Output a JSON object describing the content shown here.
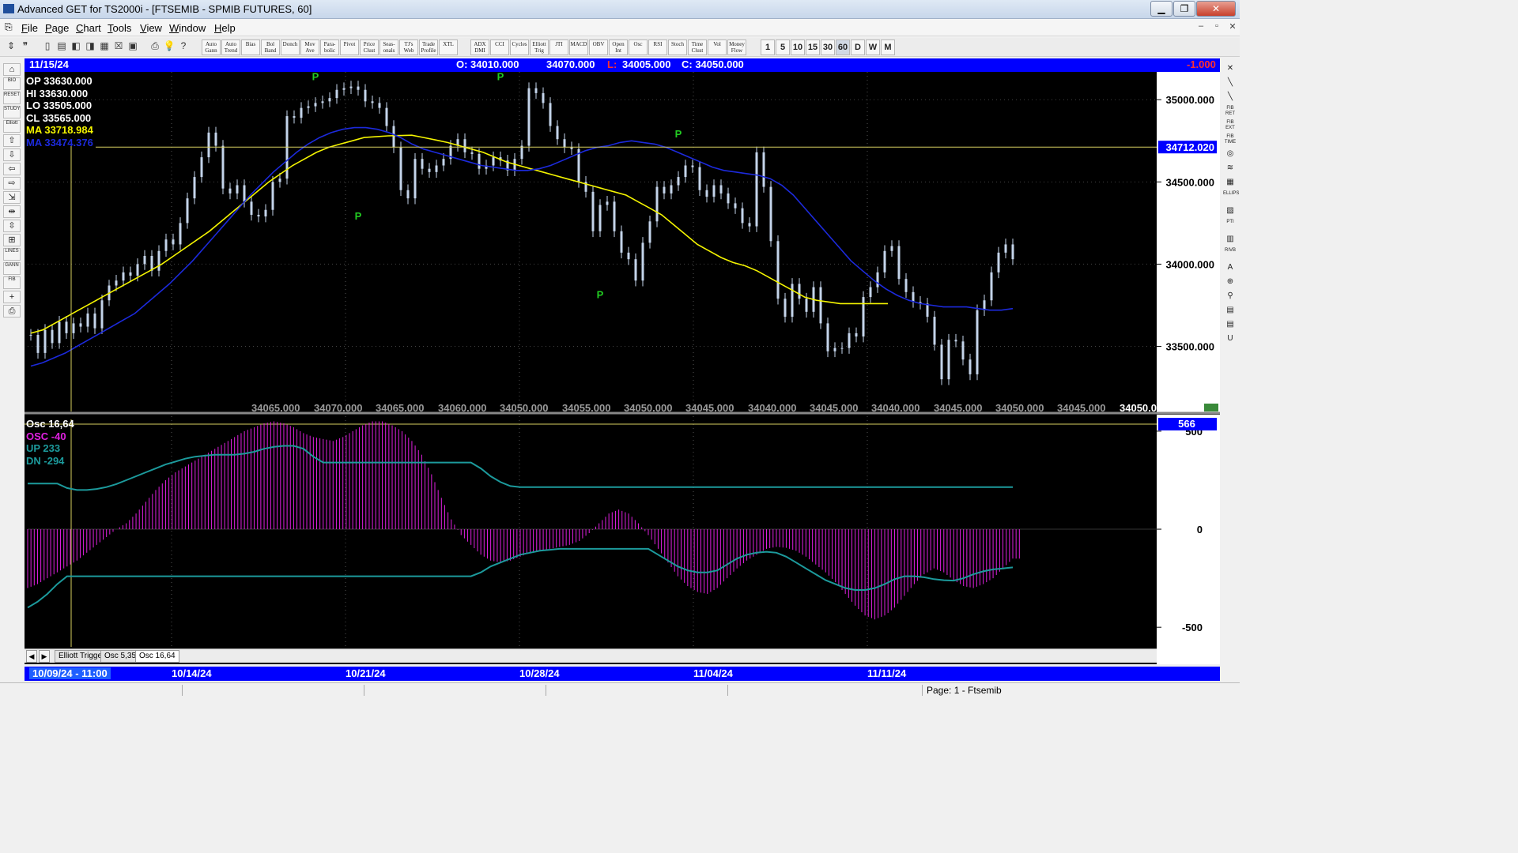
{
  "window": {
    "title": "Advanced GET for TS2000i - [FTSEMIB - SPMIB FUTURES, 60]",
    "minimize": "▁",
    "restore": "❐",
    "close": "✕"
  },
  "menu": {
    "items": [
      "File",
      "Page",
      "Chart",
      "Tools",
      "View",
      "Window",
      "Help"
    ],
    "mdi_min": "–",
    "mdi_restore": "▫",
    "mdi_close": "✕"
  },
  "toolbar": {
    "study_buttons": [
      "Auto\nGann",
      "Auto\nTrend",
      "Bias",
      "Bol\nBand",
      "Donch",
      "Mov\nAve",
      "Para-\nbolic",
      "Pivot",
      "Price\nClust",
      "Seas-\nonals",
      "TJ's\nWeb",
      "Trade\nProfile",
      "XTL"
    ],
    "indicator_buttons": [
      "ADX\nDMI",
      "CCI",
      "Cycles",
      "Elliott\nTrig",
      "JTI",
      "MACD",
      "OBV",
      "Open\nInt",
      "Osc",
      "RSI",
      "Stoch",
      "Time\nClust",
      "Vol",
      "Money\nFlow"
    ],
    "interval_buttons": [
      "1",
      "5",
      "10",
      "15",
      "30",
      "60",
      "D",
      "W",
      "M"
    ],
    "selected_interval": "60"
  },
  "left_tools": [
    "⌂",
    "BIO",
    "RESET",
    "STUDY",
    "Elliott",
    "⇧",
    "⇩",
    "⇦",
    "⇨",
    "⇲",
    "⇹",
    "⇳",
    "⊞",
    "LINES",
    "GANN",
    "FIB",
    "+",
    "⎙"
  ],
  "right_tools": [
    "✕",
    "╲",
    "╲",
    "FIB RET",
    "FIB EXT",
    "FIB TIME",
    "◎",
    "≋",
    "▦",
    "ELLIPS",
    "▨",
    "PTI",
    "▥",
    "RIVB",
    "A",
    "⊕",
    "⚲",
    "▤",
    "▤",
    "U"
  ],
  "info_bar": {
    "date": "11/15/24",
    "open": "O: 34010.000",
    "high": "34070.000",
    "low_label": "L:",
    "low": "34005.000",
    "close": "C: 34050.000",
    "change": "-1.000"
  },
  "price_legend": {
    "op": "OP  33630.000",
    "hi": "HI   33630.000",
    "lo": "LO  33505.000",
    "cl": "CL  33565.000",
    "ma1": "MA  33718.984",
    "ma2": "MA  33474.376"
  },
  "osc_legend": {
    "name": "Osc 16,64",
    "osc": "OSC -40",
    "up": "UP   233",
    "dn": "DN   -294"
  },
  "colors": {
    "price_bar": "#c4d4ea",
    "ma_fast": "#f4f400",
    "ma_slow": "#1c2adc",
    "osc_hist": "#e020e0",
    "osc_band": "#1c9a9c",
    "pivot": "#22cc22",
    "cursor": "#d8d060",
    "axis_box": "#0000ff"
  },
  "chart_data": [
    {
      "type": "line",
      "title": "FTSEMIB - SPMIB FUTURES, 60",
      "ylabel": "",
      "ylim": [
        33200,
        35150
      ],
      "y_ticks": [
        "35000.000",
        "34500.000",
        "34000.000",
        "33500.000"
      ],
      "y_tick_values": [
        35000,
        34500,
        34000,
        33500
      ],
      "cursor_price": "34712.020",
      "cursor_value": 34712.02,
      "x_categories": [
        "10/09/24 - 11:00",
        "10/14/24",
        "10/21/24",
        "10/28/24",
        "11/04/24",
        "11/11/24"
      ],
      "bottom_readings": [
        "34065.000",
        "34070.000",
        "34065.000",
        "34060.000",
        "34050.000",
        "34055.000",
        "34050.000",
        "34045.000",
        "34040.000",
        "34045.000",
        "34040.000",
        "34045.000",
        "34050.000",
        "34045.000",
        "34050.000"
      ],
      "pivots": [
        {
          "label": "P",
          "bar": 40,
          "value": 35120
        },
        {
          "label": "P",
          "bar": 46,
          "value": 34320
        },
        {
          "label": "P",
          "bar": 66,
          "value": 35120
        },
        {
          "label": "P",
          "bar": 80,
          "value": 33840
        },
        {
          "label": "P",
          "bar": 91,
          "value": 34770
        }
      ],
      "series": [
        {
          "name": "Price",
          "values": [
            33570,
            33460,
            33600,
            33520,
            33650,
            33580,
            33640,
            33620,
            33700,
            33610,
            33780,
            33870,
            33900,
            33950,
            33930,
            34000,
            34050,
            33960,
            34080,
            34150,
            34120,
            34250,
            34400,
            34530,
            34650,
            34800,
            34720,
            34460,
            34430,
            34480,
            34380,
            34300,
            34290,
            34330,
            34500,
            34520,
            34900,
            34890,
            34950,
            34960,
            34980,
            34990,
            35010,
            35060,
            35070,
            35080,
            35060,
            34990,
            34980,
            34950,
            34840,
            34710,
            34450,
            34400,
            34640,
            34580,
            34560,
            34600,
            34640,
            34720,
            34760,
            34680,
            34670,
            34580,
            34600,
            34650,
            34630,
            34570,
            34640,
            34720,
            35070,
            35040,
            34980,
            34840,
            34760,
            34710,
            34700,
            34500,
            34440,
            34200,
            34360,
            34380,
            34200,
            34070,
            34030,
            33900,
            34130,
            34260,
            34470,
            34430,
            34480,
            34530,
            34600,
            34590,
            34450,
            34410,
            34480,
            34430,
            34370,
            34340,
            34250,
            34230,
            34680,
            34470,
            34140,
            33790,
            33680,
            33880,
            33790,
            33710,
            33860,
            33640,
            33470,
            33490,
            33490,
            33580,
            33560,
            33800,
            33860,
            33950,
            34080,
            34110,
            33910,
            33830,
            33770,
            33760,
            33680,
            33510,
            33300,
            33540,
            33530,
            33420,
            33330,
            33720,
            33780,
            33950,
            34070,
            34120,
            34030
          ]
        },
        {
          "name": "MA",
          "values": [
            33580,
            33600,
            33640,
            33680,
            33720,
            33760,
            33800,
            33840,
            33880,
            33920,
            33960,
            34000,
            34050,
            34100,
            34150,
            34200,
            34260,
            34320,
            34380,
            34440,
            34500,
            34550,
            34600,
            34640,
            34680,
            34710,
            34730,
            34750,
            34770,
            34775,
            34780,
            34782,
            34784,
            34770,
            34755,
            34740,
            34720,
            34700,
            34680,
            34650,
            34620,
            34600,
            34580,
            34560,
            34540,
            34520,
            34500,
            34480,
            34460,
            34440,
            34420,
            34380,
            34340,
            34300,
            34240,
            34180,
            34120,
            34080,
            34040,
            34010,
            33990,
            33960,
            33920,
            33880,
            33840,
            33800,
            33780,
            33770,
            33760,
            33760,
            33760,
            33760,
            33760
          ]
        },
        {
          "name": "MA",
          "values": [
            33380,
            33400,
            33430,
            33460,
            33500,
            33540,
            33580,
            33620,
            33660,
            33700,
            33760,
            33820,
            33880,
            33950,
            34020,
            34100,
            34180,
            34260,
            34340,
            34420,
            34490,
            34560,
            34620,
            34680,
            34730,
            34770,
            34800,
            34820,
            34830,
            34830,
            34820,
            34800,
            34770,
            34730,
            34700,
            34680,
            34660,
            34640,
            34620,
            34600,
            34590,
            34580,
            34570,
            34570,
            34580,
            34600,
            34630,
            34660,
            34690,
            34710,
            34720,
            34740,
            34750,
            34740,
            34730,
            34710,
            34680,
            34650,
            34620,
            34590,
            34570,
            34560,
            34550,
            34540,
            34520,
            34480,
            34420,
            34340,
            34260,
            34180,
            34100,
            34020,
            33960,
            33900,
            33850,
            33810,
            33780,
            33760,
            33750,
            33740,
            33740,
            33740,
            33730,
            33720,
            33720,
            33730
          ]
        }
      ]
    },
    {
      "type": "bar",
      "title": "Osc 16,64",
      "ylim": [
        -600,
        560
      ],
      "y_ticks": [
        "500",
        "0",
        "-500"
      ],
      "y_tick_values": [
        500,
        0,
        -500
      ],
      "current_value_label": "566",
      "series": [
        {
          "name": "OSC",
          "values": [
            -300,
            -280,
            -250,
            -220,
            -190,
            -160,
            -120,
            -80,
            -40,
            0,
            30,
            80,
            140,
            200,
            250,
            290,
            320,
            350,
            380,
            410,
            440,
            470,
            500,
            520,
            540,
            550,
            540,
            520,
            490,
            470,
            460,
            450,
            470,
            500,
            530,
            550,
            550,
            530,
            500,
            450,
            380,
            280,
            160,
            50,
            -30,
            -80,
            -130,
            -160,
            -170,
            -160,
            -140,
            -120,
            -110,
            -100,
            -90,
            -80,
            -60,
            -20,
            30,
            80,
            100,
            80,
            30,
            -30,
            -100,
            -170,
            -240,
            -290,
            -320,
            -330,
            -300,
            -250,
            -200,
            -160,
            -130,
            -100,
            -90,
            -95,
            -110,
            -140,
            -180,
            -220,
            -270,
            -330,
            -390,
            -440,
            -460,
            -440,
            -400,
            -340,
            -280,
            -230,
            -200,
            -220,
            -260,
            -290,
            -300,
            -280,
            -250,
            -200,
            -150
          ]
        },
        {
          "name": "UP",
          "values": [
            233,
            233,
            233,
            233,
            210,
            200,
            200,
            205,
            215,
            230,
            250,
            270,
            290,
            310,
            330,
            345,
            360,
            370,
            375,
            380,
            380,
            380,
            385,
            395,
            410,
            420,
            425,
            425,
            410,
            370,
            340,
            340,
            340,
            340,
            340,
            340,
            340,
            340,
            340,
            340,
            340,
            340,
            340,
            340,
            340,
            340,
            310,
            270,
            240,
            220,
            215,
            215,
            215,
            215,
            215,
            215,
            215,
            215,
            215,
            215,
            215,
            215,
            215,
            215,
            215,
            215,
            215,
            215,
            215,
            215,
            215,
            215,
            215,
            215,
            215,
            215,
            215,
            215,
            215,
            215,
            215,
            215,
            215,
            215,
            215,
            215,
            215,
            215,
            215,
            215,
            215,
            215,
            215,
            215,
            215,
            215,
            215,
            215,
            215,
            215,
            215
          ]
        },
        {
          "name": "DN",
          "values": [
            -400,
            -370,
            -330,
            -280,
            -240,
            -240,
            -240,
            -240,
            -240,
            -240,
            -240,
            -240,
            -240,
            -240,
            -240,
            -240,
            -240,
            -240,
            -240,
            -240,
            -240,
            -240,
            -240,
            -240,
            -240,
            -240,
            -240,
            -240,
            -240,
            -240,
            -240,
            -240,
            -240,
            -240,
            -240,
            -240,
            -240,
            -240,
            -240,
            -240,
            -240,
            -240,
            -240,
            -240,
            -240,
            -240,
            -220,
            -190,
            -170,
            -150,
            -130,
            -120,
            -110,
            -105,
            -100,
            -100,
            -100,
            -100,
            -100,
            -100,
            -100,
            -100,
            -100,
            -100,
            -130,
            -160,
            -190,
            -210,
            -220,
            -220,
            -210,
            -180,
            -150,
            -130,
            -120,
            -115,
            -120,
            -140,
            -170,
            -200,
            -230,
            -260,
            -280,
            -300,
            -310,
            -310,
            -300,
            -280,
            -255,
            -240,
            -240,
            -245,
            -255,
            -260,
            -262,
            -250,
            -230,
            -215,
            -205,
            -200,
            -195
          ]
        }
      ]
    }
  ],
  "tabs": [
    "Elliott Trigger",
    "Osc 5,35",
    "Osc 16,64"
  ],
  "active_tab": "Osc 16,64",
  "status": {
    "page": "Page: 1 - Ftsemib"
  }
}
